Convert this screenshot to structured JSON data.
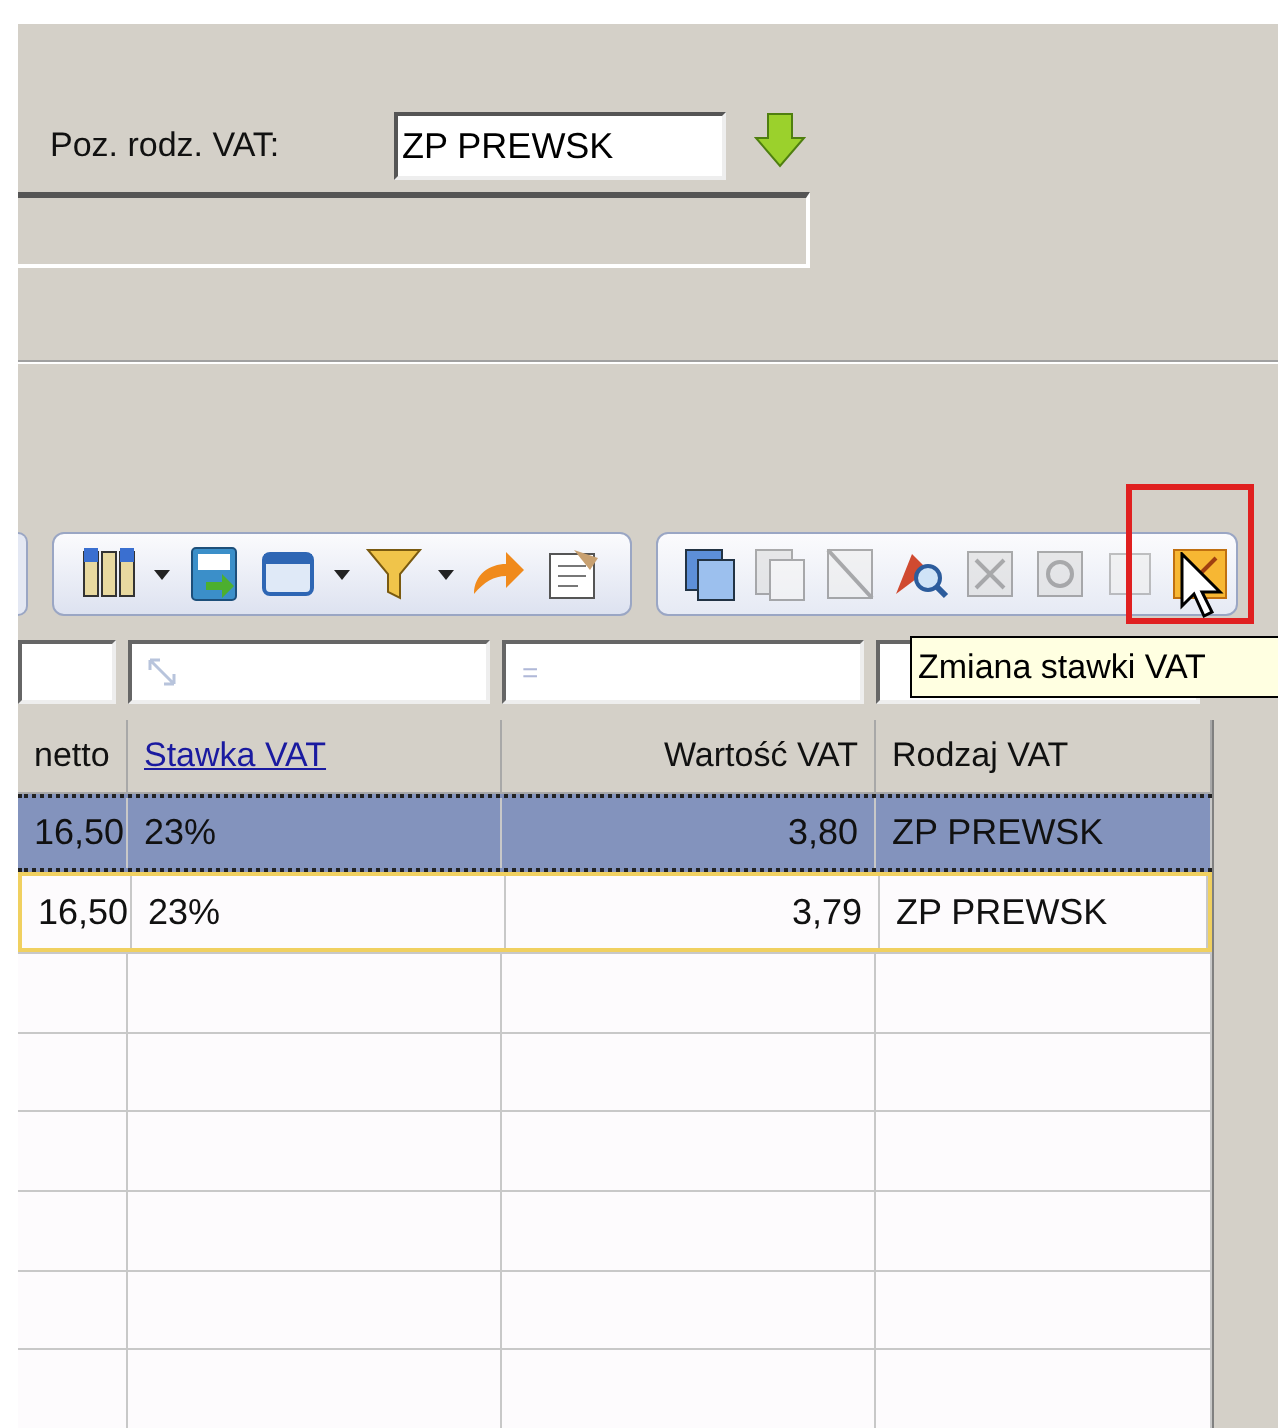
{
  "vat_field": {
    "label": "Poz. rodz. VAT:",
    "value": "ZP PREWSK"
  },
  "filters": [
    {
      "kind": "blank"
    },
    {
      "kind": "icon"
    },
    {
      "kind": "text",
      "text": "="
    },
    {
      "kind": "blank"
    }
  ],
  "table": {
    "columns": [
      {
        "label": "netto",
        "link": false,
        "kind": "text"
      },
      {
        "label": "Stawka VAT",
        "link": true,
        "kind": "text"
      },
      {
        "label": "Wartość VAT",
        "link": false,
        "kind": "number"
      },
      {
        "label": "Rodzaj VAT",
        "link": false,
        "kind": "text"
      }
    ],
    "rows": [
      {
        "cells": [
          "16,50",
          "23%",
          "3,80",
          "ZP PREWSK"
        ],
        "selected": true,
        "focused": false
      },
      {
        "cells": [
          "16,50",
          "23%",
          "3,79",
          "ZP PREWSK"
        ],
        "selected": false,
        "focused": true
      }
    ]
  },
  "tooltip": "Zmiana stawki VAT"
}
